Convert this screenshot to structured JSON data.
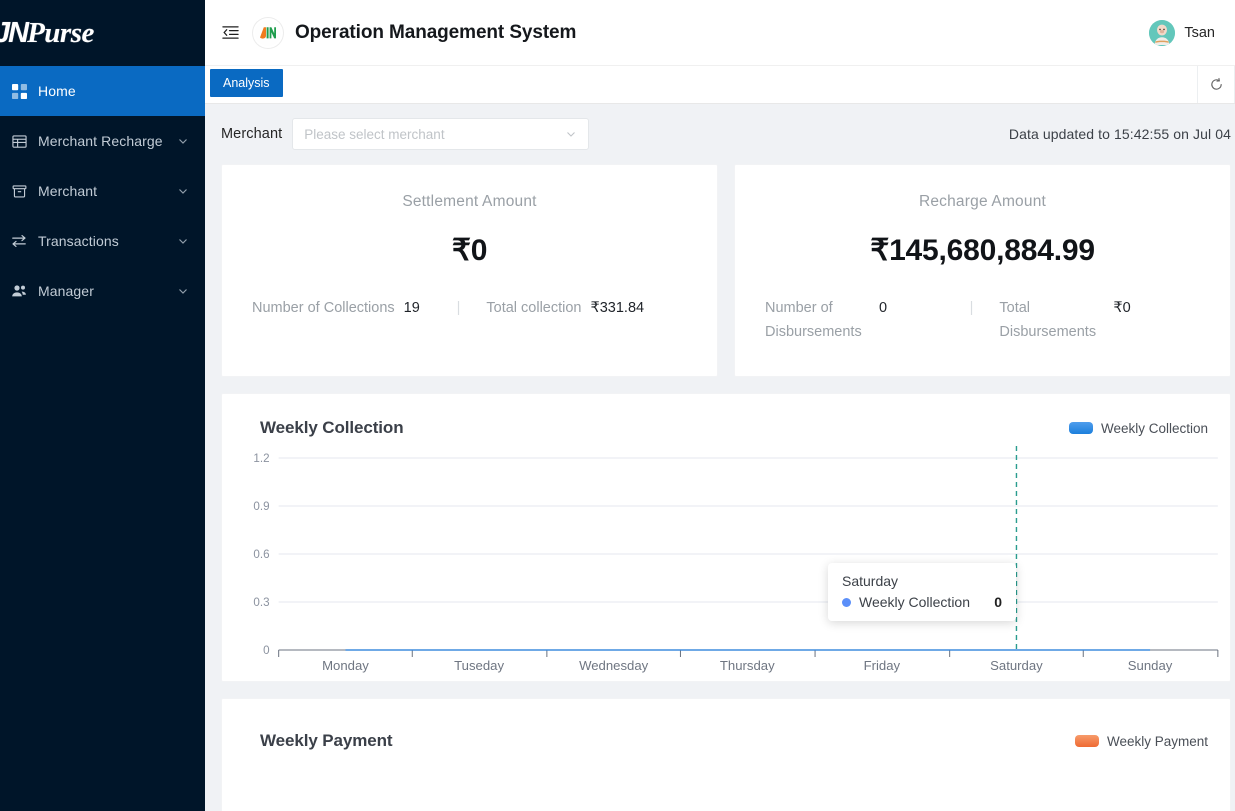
{
  "sidebar": {
    "brand": {
      "jn": "JN",
      "rest": "Purse"
    },
    "items": [
      {
        "label": "Home",
        "icon": "dashboard-icon",
        "active": true,
        "expandable": false
      },
      {
        "label": "Merchant Recharge",
        "icon": "table-icon",
        "active": false,
        "expandable": true
      },
      {
        "label": "Merchant",
        "icon": "archive-icon",
        "active": false,
        "expandable": true
      },
      {
        "label": "Transactions",
        "icon": "swap-icon",
        "active": false,
        "expandable": true
      },
      {
        "label": "Manager",
        "icon": "users-icon",
        "active": false,
        "expandable": true
      }
    ]
  },
  "topbar": {
    "collapse_icon": "menu-fold-icon",
    "logo_icon": "jn-logo-icon",
    "title": "Operation Management System",
    "user": {
      "name": "Tsan",
      "avatar_icon": "user-avatar"
    }
  },
  "tabs": {
    "items": [
      {
        "label": "Analysis",
        "active": true
      }
    ],
    "actions": [
      {
        "icon": "refresh-icon",
        "name": "refresh-button"
      }
    ]
  },
  "filter": {
    "merchant_label": "Merchant",
    "merchant_placeholder": "Please select merchant",
    "merchant_value": "",
    "updated_text": "Data updated to 15:42:55 on Jul 04"
  },
  "cards": [
    {
      "title": "Settlement Amount",
      "amount": "₹0",
      "stats": [
        {
          "label": "Number of Collections",
          "value": "19"
        },
        {
          "label": "Total collection",
          "value": "₹331.84"
        }
      ]
    },
    {
      "title": "Recharge Amount",
      "amount": "₹145,680,884.99",
      "stats": [
        {
          "label": "Number of Disbursements",
          "value": "0"
        },
        {
          "label": "Total Disbursements",
          "value": "₹0"
        }
      ]
    }
  ],
  "panels": [
    {
      "title": "Weekly Collection",
      "legend_label": "Weekly Collection",
      "legend_color": "#2f8ae8"
    },
    {
      "title": "Weekly Payment",
      "legend_label": "Weekly Payment",
      "legend_color": "#f0763c"
    }
  ],
  "tooltip": {
    "title": "Saturday",
    "series_name": "Weekly Collection",
    "value": "0",
    "dot_color": "#5b8ff9"
  },
  "chart_data": {
    "type": "line",
    "title": "Weekly Collection",
    "xlabel": "",
    "ylabel": "",
    "categories": [
      "Monday",
      "Tuseday",
      "Wednesday",
      "Thursday",
      "Friday",
      "Saturday",
      "Sunday"
    ],
    "series": [
      {
        "name": "Weekly Collection",
        "color": "#2f8ae8",
        "values": [
          0,
          0,
          0,
          0,
          0,
          0,
          0
        ]
      }
    ],
    "yticks": [
      "0",
      "0.3",
      "0.6",
      "0.9",
      "1.2"
    ],
    "ylim": [
      0,
      1.2
    ],
    "grid": true,
    "legend_position": "top-right",
    "highlight": {
      "category": "Saturday",
      "value": 0,
      "line_color": "#2a9d8f",
      "style": "dashed"
    }
  },
  "colors": {
    "sidebar_bg": "#001529",
    "accent": "#0a6ac2",
    "page_bg": "#f0f2f5",
    "card_bg": "#ffffff"
  }
}
